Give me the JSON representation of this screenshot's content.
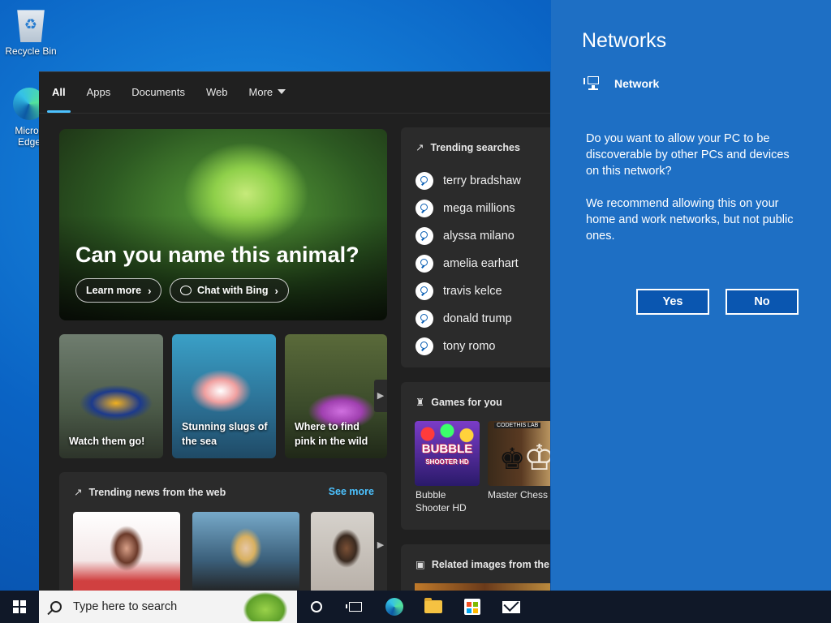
{
  "desktop": {
    "recycle_bin_label": "Recycle Bin",
    "edge_label_line1": "Micros",
    "edge_label_line2": "Edge"
  },
  "search_panel": {
    "tabs": [
      "All",
      "Apps",
      "Documents",
      "Web",
      "More"
    ],
    "active_tab": "All",
    "hero": {
      "title": "Can you name this animal?",
      "learn_more": "Learn more",
      "chat_with_bing": "Chat with Bing"
    },
    "thumbnails": [
      {
        "caption": "Watch them go!"
      },
      {
        "caption": "Stunning slugs of the sea"
      },
      {
        "caption": "Where to find pink in the wild"
      }
    ],
    "trending_news": {
      "title": "Trending news from the web",
      "see_more": "See more"
    },
    "trending_searches": {
      "title": "Trending searches",
      "items": [
        "terry bradshaw",
        "mega millions",
        "alyssa milano",
        "amelia earhart",
        "travis kelce",
        "donald trump",
        "tony romo"
      ]
    },
    "games": {
      "title": "Games for you",
      "items": [
        {
          "name_line1": "Bubble",
          "name_line2": "Shooter HD",
          "art_text": "BUBBLE",
          "art_sub": "SHOOTER HD"
        },
        {
          "name_line1": "Master Chess",
          "name_line2": "",
          "art_tag": "CODETHIS LAB"
        }
      ]
    },
    "related_images": {
      "title": "Related images from the"
    }
  },
  "network_flyout": {
    "title": "Networks",
    "network_name": "Network",
    "question": "Do you want to allow your PC to be discoverable by other PCs and devices on this network?",
    "recommendation": "We recommend allowing this on your home and work networks, but not public ones.",
    "yes_label": "Yes",
    "no_label": "No",
    "accent_color": "#1e6fc4"
  },
  "taskbar": {
    "search_placeholder": "Type here to search",
    "icons": [
      "start-icon",
      "cortana-icon",
      "task-view-icon",
      "edge-icon",
      "file-explorer-icon",
      "store-icon",
      "mail-icon"
    ]
  }
}
